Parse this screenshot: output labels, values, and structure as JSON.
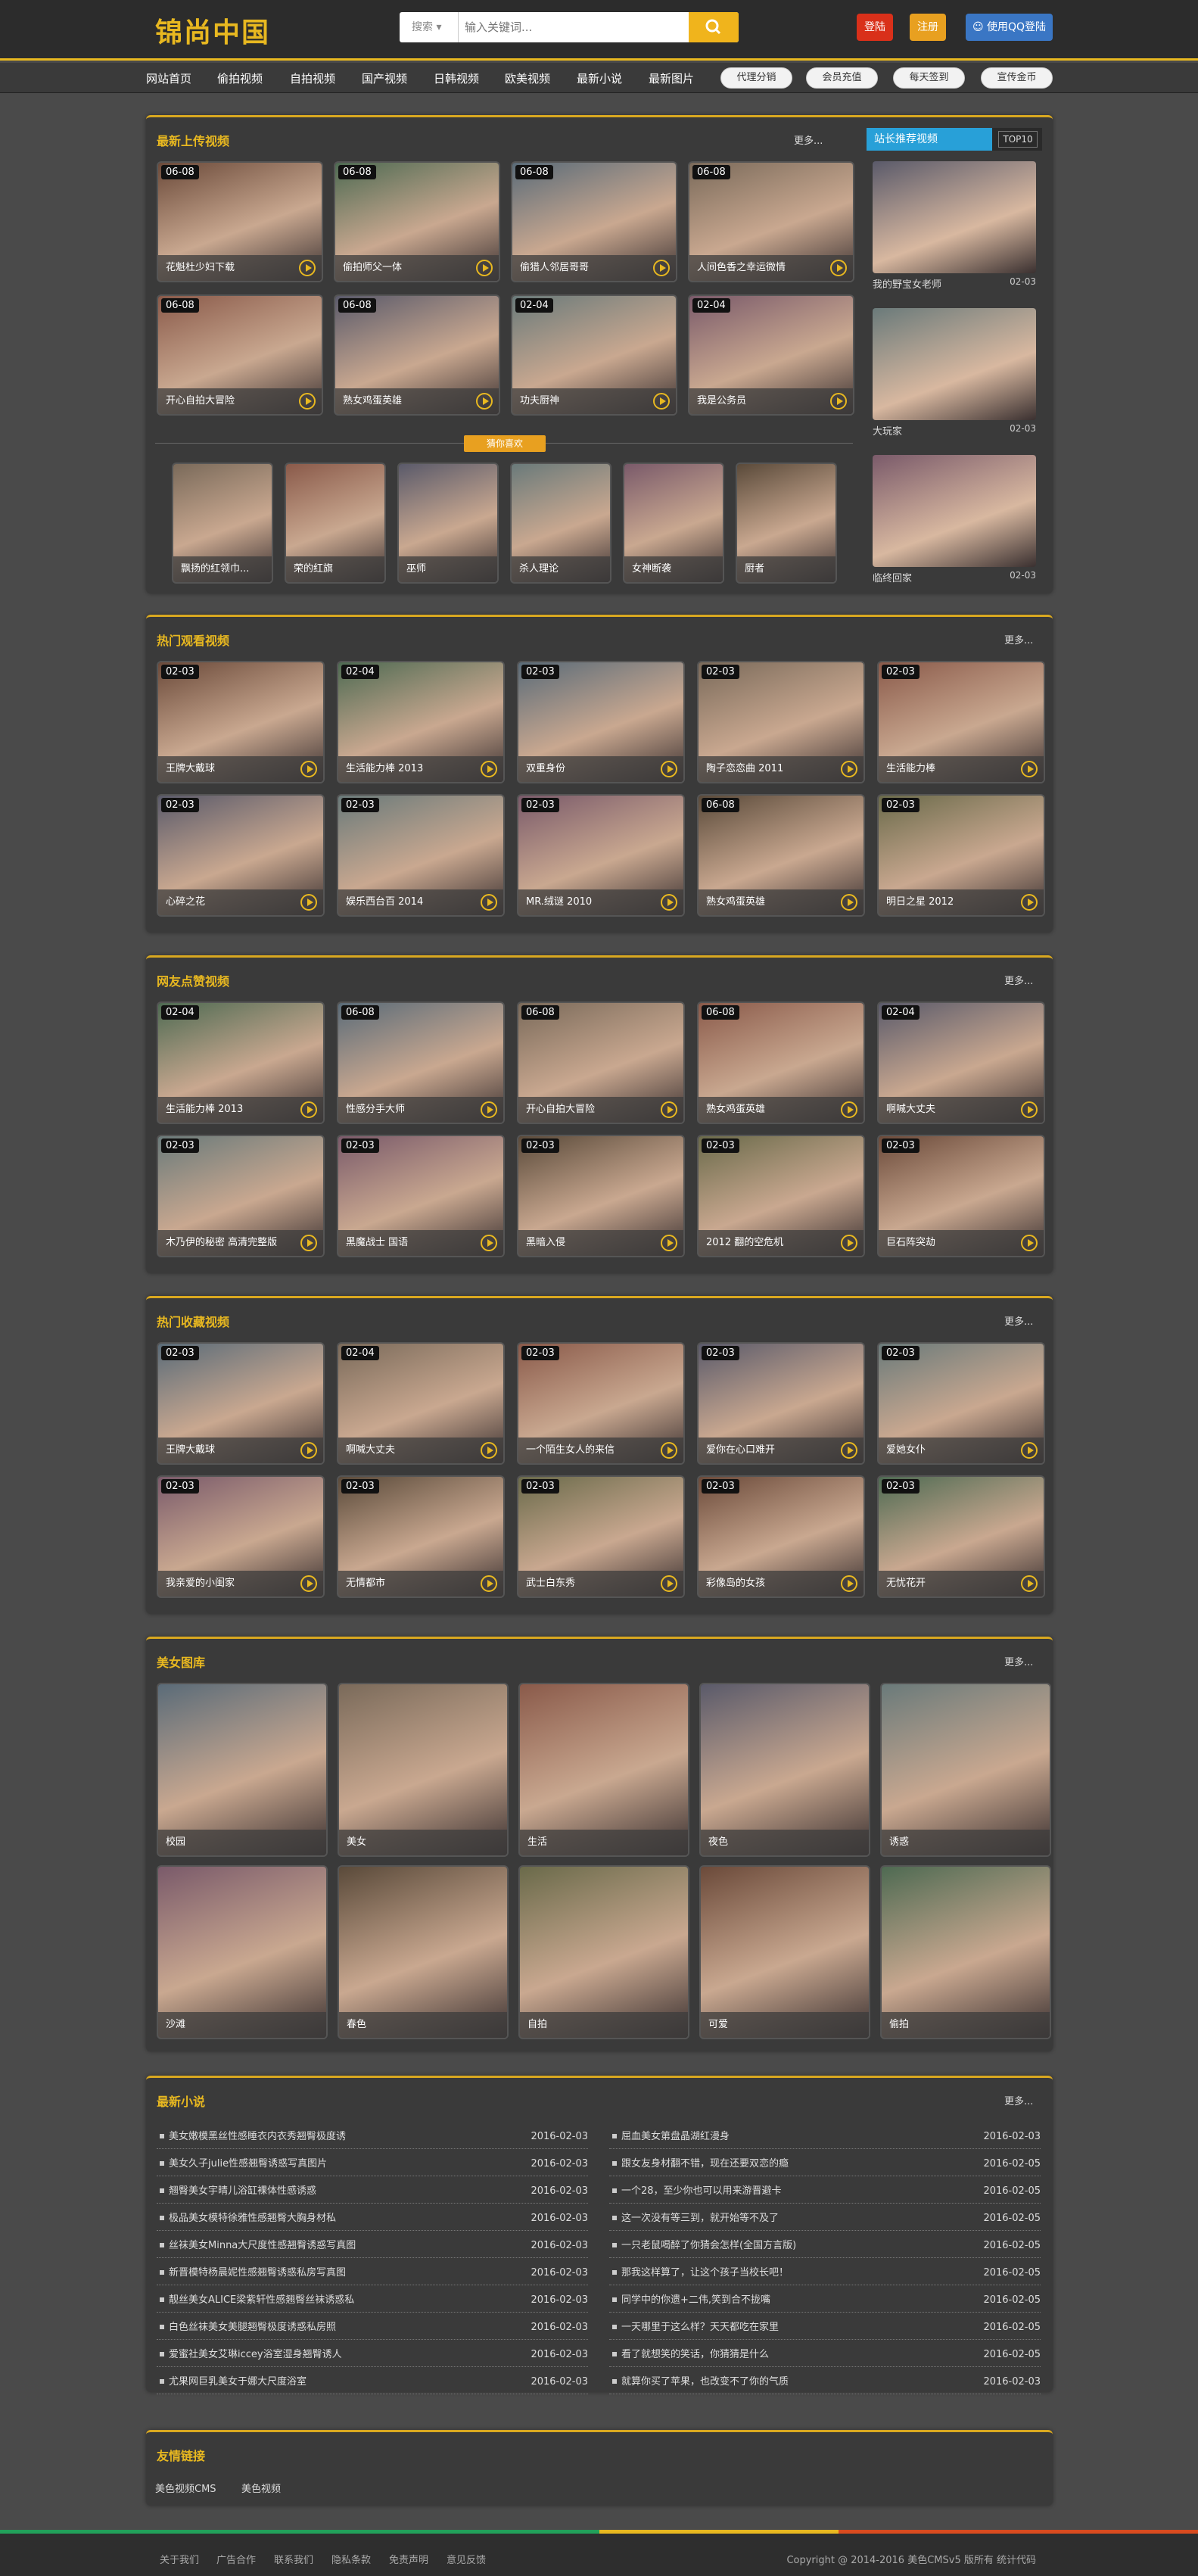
{
  "header": {
    "logo": "锦尚中国",
    "search_select": "搜索 ▾",
    "search_placeholder": "输入关键词...",
    "login": "登陆",
    "register": "注册",
    "qq_login": "使用QQ登陆"
  },
  "nav": {
    "items": [
      "网站首页",
      "偷拍视频",
      "自拍视频",
      "国产视频",
      "日韩视频",
      "欧美视频",
      "最新小说",
      "最新图片"
    ],
    "pills": [
      "代理分销",
      "会员充值",
      "每天签到",
      "宣传金币"
    ]
  },
  "latest": {
    "title": "最新上传视频",
    "more": "更多...",
    "items": [
      {
        "date": "06-08",
        "cap": "花魁杜少妇下载"
      },
      {
        "date": "06-08",
        "cap": "偷拍师父一体"
      },
      {
        "date": "06-08",
        "cap": "偷猎人邻居哥哥"
      },
      {
        "date": "06-08",
        "cap": "人间色香之幸运微情"
      },
      {
        "date": "06-08",
        "cap": "开心自拍大冒险"
      },
      {
        "date": "06-08",
        "cap": "熟女鸡蛋英雄"
      },
      {
        "date": "02-04",
        "cap": "功夫厨神"
      },
      {
        "date": "02-04",
        "cap": "我是公务员"
      }
    ],
    "guess_label": "猜你喜欢",
    "guess": [
      "飘扬的红领巾...",
      "荣的红旗",
      "巫师",
      "杀人理论",
      "女神断袭",
      "厨者"
    ],
    "rank_tab": "站长推荐视频",
    "rank_top": "TOP10",
    "rank": [
      {
        "cap": "我的野宝女老师",
        "date": "02-03"
      },
      {
        "cap": "大玩家",
        "date": "02-03"
      },
      {
        "cap": "临终回家",
        "date": "02-03"
      }
    ]
  },
  "hot": {
    "title": "热门观看视频",
    "more": "更多...",
    "items": [
      {
        "date": "02-03",
        "cap": "王牌大戴球"
      },
      {
        "date": "02-04",
        "cap": "生活能力棒 2013"
      },
      {
        "date": "02-03",
        "cap": "双重身份"
      },
      {
        "date": "02-03",
        "cap": "陶子恋恋曲 2011"
      },
      {
        "date": "02-03",
        "cap": "生活能力棒"
      },
      {
        "date": "02-03",
        "cap": "心碎之花"
      },
      {
        "date": "02-03",
        "cap": "娱乐西台百 2014"
      },
      {
        "date": "02-03",
        "cap": "MR.绒谜 2010"
      },
      {
        "date": "06-08",
        "cap": "熟女鸡蛋英雄"
      },
      {
        "date": "02-03",
        "cap": "明日之星 2012"
      }
    ]
  },
  "liked": {
    "title": "网友点赞视频",
    "more": "更多...",
    "items": [
      {
        "date": "02-04",
        "cap": "生活能力棒 2013"
      },
      {
        "date": "06-08",
        "cap": "性感分手大师"
      },
      {
        "date": "06-08",
        "cap": "开心自拍大冒险"
      },
      {
        "date": "06-08",
        "cap": "熟女鸡蛋英雄"
      },
      {
        "date": "02-04",
        "cap": "啊喊大丈夫"
      },
      {
        "date": "02-03",
        "cap": "木乃伊的秘密 高清完整版"
      },
      {
        "date": "02-03",
        "cap": "黑魔战士 国语"
      },
      {
        "date": "02-03",
        "cap": "黑暗入侵"
      },
      {
        "date": "02-03",
        "cap": "2012 翻的空危机"
      },
      {
        "date": "02-03",
        "cap": "巨石阵突劫"
      }
    ]
  },
  "fav": {
    "title": "热门收藏视频",
    "more": "更多...",
    "items": [
      {
        "date": "02-03",
        "cap": "王牌大戴球"
      },
      {
        "date": "02-04",
        "cap": "啊喊大丈夫"
      },
      {
        "date": "02-03",
        "cap": "一个陌生女人的来信"
      },
      {
        "date": "02-03",
        "cap": "爱你在心口难开"
      },
      {
        "date": "02-03",
        "cap": "爱她女仆"
      },
      {
        "date": "02-03",
        "cap": "我亲爱的小闺家"
      },
      {
        "date": "02-03",
        "cap": "无情都市"
      },
      {
        "date": "02-03",
        "cap": "武士白东秀"
      },
      {
        "date": "02-03",
        "cap": "彩像岛的女孩"
      },
      {
        "date": "02-03",
        "cap": "无忧花开"
      }
    ]
  },
  "gallery": {
    "title": "美女图库",
    "more": "更多...",
    "items": [
      "校园",
      "美女",
      "生活",
      "夜色",
      "诱惑",
      "沙滩",
      "春色",
      "自拍",
      "可爱",
      "偷拍"
    ]
  },
  "novels": {
    "title": "最新小说",
    "more": "更多...",
    "left": [
      {
        "t": "美女嫩模黑丝性感睡衣内衣秀翘臀极度诱",
        "d": "2016-02-03"
      },
      {
        "t": "美女久子julie性感翘臀诱惑写真图片",
        "d": "2016-02-03"
      },
      {
        "t": "翘臀美女宇晴儿浴缸裸体性感诱惑",
        "d": "2016-02-03"
      },
      {
        "t": "极品美女模特徐雅性感翘臀大胸身材私",
        "d": "2016-02-03"
      },
      {
        "t": "丝袜美女Minna大尺度性感翘臀诱惑写真图",
        "d": "2016-02-03"
      },
      {
        "t": "新晋模特杨晨妮性感翘臀诱惑私房写真图",
        "d": "2016-02-03"
      },
      {
        "t": "靓丝美女ALICE梁紫轩性感翘臀丝袜诱惑私",
        "d": "2016-02-03"
      },
      {
        "t": "白色丝袜美女美腿翘臀极度诱惑私房照",
        "d": "2016-02-03"
      },
      {
        "t": "爱蜜社美女艾琳iccey浴室湿身翘臀诱人",
        "d": "2016-02-03"
      },
      {
        "t": "尤果网巨乳美女于娜大尺度浴室",
        "d": "2016-02-03"
      }
    ],
    "right": [
      {
        "t": "屈血美女第盘晶湖红漫身",
        "d": "2016-02-03"
      },
      {
        "t": "跟女友身材翻不错，现在还要双恋的瘾",
        "d": "2016-02-05"
      },
      {
        "t": "一个28，至少你也可以用来游晋避卡",
        "d": "2016-02-05"
      },
      {
        "t": "这一次没有等三到，就开始等不及了",
        "d": "2016-02-05"
      },
      {
        "t": "一只老鼠喝醉了你猜会怎样(全国方言版)",
        "d": "2016-02-05"
      },
      {
        "t": "那我这样算了，让这个孩子当校长吧！",
        "d": "2016-02-05"
      },
      {
        "t": "同学中的你遗+二伟,笑到合不拢嘴",
        "d": "2016-02-05"
      },
      {
        "t": "一天哪里于这么样？天天都吃在家里",
        "d": "2016-02-05"
      },
      {
        "t": "看了就想笑的笑话，你猜猜是什么",
        "d": "2016-02-05"
      },
      {
        "t": "就算你买了苹果，也改变不了你的气质",
        "d": "2016-02-03"
      }
    ]
  },
  "links": {
    "title": "友情链接",
    "items": [
      "美色视频CMS",
      "美色视频"
    ]
  },
  "footer": {
    "links": [
      "关于我们",
      "广告合作",
      "联系我们",
      "隐私条款",
      "免责声明",
      "意见反馈"
    ],
    "copyright": "Copyright @ 2014-2016 美色CMSv5 版所有 统计代码"
  },
  "colors": {
    "accent": "#e8b820",
    "rank_tab": "#28a0d8",
    "login": "#d9301a",
    "register": "#e8a020",
    "qq": "#3a76c4"
  }
}
